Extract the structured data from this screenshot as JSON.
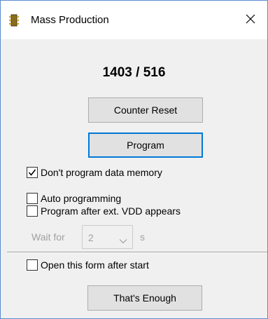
{
  "window": {
    "title": "Mass Production",
    "close_glyph": "✕",
    "app_icon": "chip-icon"
  },
  "counter": {
    "text": "1403 / 516"
  },
  "buttons": {
    "counter_reset": "Counter Reset",
    "program": "Program",
    "thats_enough": "That's Enough"
  },
  "options": {
    "dont_program_data_memory": {
      "label": "Don't program data memory",
      "checked": true
    },
    "auto_programming": {
      "label": "Auto programming",
      "checked": false
    },
    "program_after_vdd": {
      "label": "Program after ext. VDD appears",
      "checked": false
    },
    "open_form_after_start": {
      "label": "Open this form after start",
      "checked": false
    }
  },
  "wait": {
    "label": "Wait for",
    "value": "2",
    "unit": "s",
    "enabled": false
  },
  "colors": {
    "accent": "#0078d7",
    "window_border": "#5a8bd0",
    "disabled_text": "#a0a0a0"
  }
}
